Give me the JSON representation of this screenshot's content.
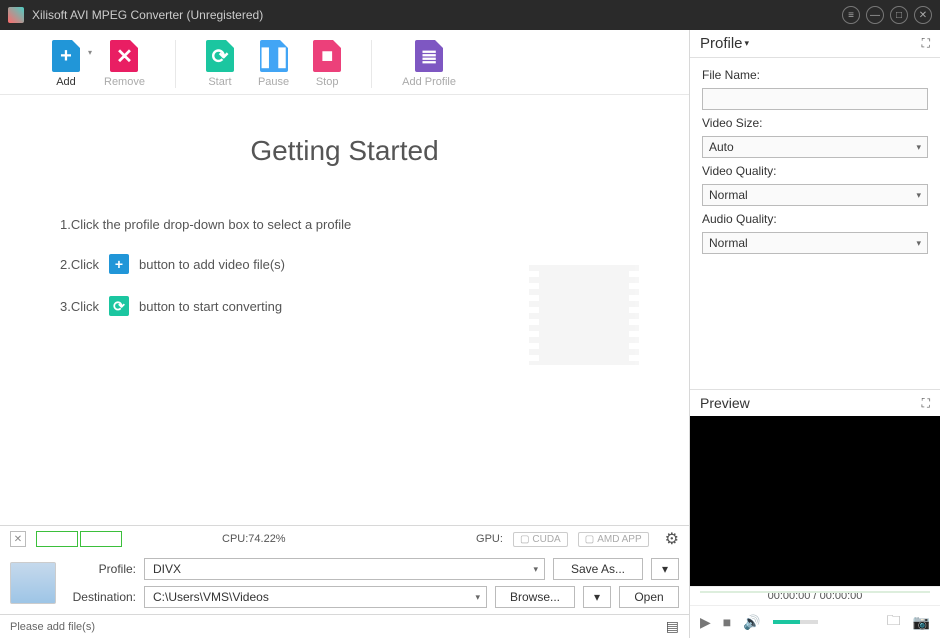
{
  "window": {
    "title": "Xilisoft AVI MPEG Converter (Unregistered)"
  },
  "toolbar": {
    "add": "Add",
    "remove": "Remove",
    "start": "Start",
    "pause": "Pause",
    "stop": "Stop",
    "addprofile": "Add Profile"
  },
  "getting_started": {
    "heading": "Getting Started",
    "step1": "1.Click the profile drop-down box to select a profile",
    "step2_a": "2.Click",
    "step2_b": "button to add video file(s)",
    "step3_a": "3.Click",
    "step3_b": "button to start converting"
  },
  "status_row": {
    "cpu_label": "CPU:",
    "cpu_value": "74.22%",
    "gpu_label": "GPU:",
    "cuda": "CUDA",
    "amd": "AMD APP"
  },
  "profile_row": {
    "profile_label": "Profile:",
    "profile_value": "DIVX",
    "saveas": "Save As...",
    "dest_label": "Destination:",
    "dest_value": "C:\\Users\\VMS\\Videos",
    "browse": "Browse...",
    "open": "Open"
  },
  "statusbar": {
    "message": "Please add file(s)"
  },
  "right": {
    "profile_header": "Profile",
    "filename_label": "File Name:",
    "filename_value": "",
    "videosize_label": "Video Size:",
    "videosize_value": "Auto",
    "videoquality_label": "Video Quality:",
    "videoquality_value": "Normal",
    "audioquality_label": "Audio Quality:",
    "audioquality_value": "Normal",
    "preview_header": "Preview",
    "time": "00:00:00 / 00:00:00"
  }
}
